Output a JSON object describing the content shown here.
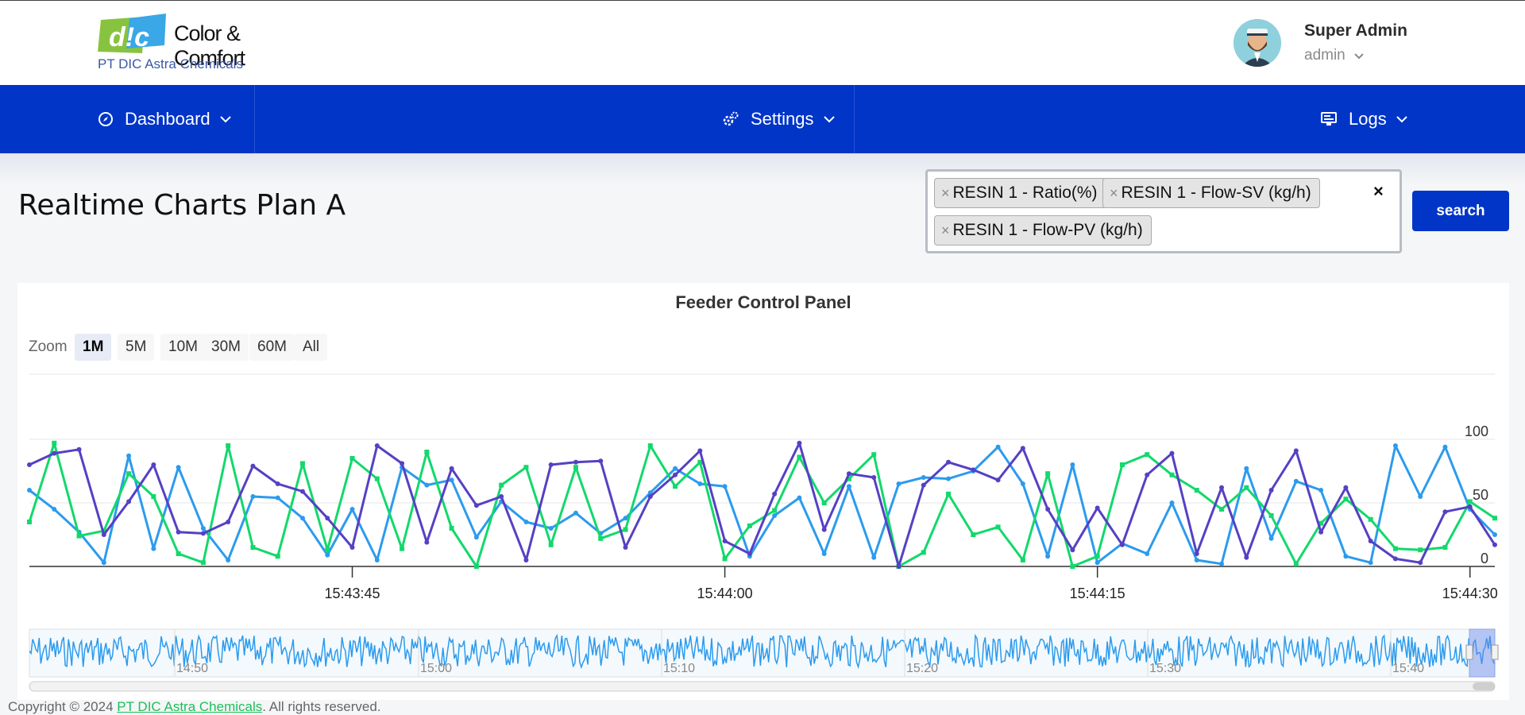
{
  "header": {
    "logo": {
      "mark": "DIC",
      "text": "Color & Comfort",
      "company": "PT DIC Astra Chemicals"
    },
    "user": {
      "name": "Super Admin",
      "role": "admin"
    }
  },
  "nav": {
    "items": [
      {
        "label": "Dashboard",
        "icon": "compass-icon"
      },
      {
        "label": "Settings",
        "icon": "gears-icon"
      },
      {
        "label": "Logs",
        "icon": "monitor-icon"
      }
    ]
  },
  "page": {
    "title": "Realtime Charts Plan A"
  },
  "filter": {
    "tags": [
      "RESIN 1 - Ratio(%)",
      "RESIN 1 - Flow-SV (kg/h)",
      "RESIN 1 - Flow-PV (kg/h)"
    ],
    "remove_symbol": "×",
    "clear_symbol": "×",
    "search_label": "search"
  },
  "colors": {
    "brand_blue": "#0035c8",
    "series_ratio": "#2b9bee",
    "series_flow_sv": "#12d96b",
    "series_flow_pv": "#5640c4",
    "footer_link": "#1cbf58"
  },
  "zoom": {
    "label": "Zoom",
    "options": [
      "1M",
      "5M",
      "10M",
      "30M",
      "60M",
      "All"
    ],
    "selected": "1M"
  },
  "chart_data": {
    "type": "line",
    "title": "Feeder Control Panel",
    "xlabel": "",
    "ylabel": "",
    "x_range": [
      "15:43:32",
      "15:44:31"
    ],
    "x_ticks": [
      "15:43:45",
      "15:44:00",
      "15:44:15",
      "15:44:30"
    ],
    "y_ticks": [
      0,
      50,
      100
    ],
    "ylim": [
      0,
      100
    ],
    "grid": true,
    "legend": "none",
    "x": [
      "15:43:32",
      "15:43:33",
      "15:43:34",
      "15:43:35",
      "15:43:36",
      "15:43:37",
      "15:43:38",
      "15:43:39",
      "15:43:40",
      "15:43:41",
      "15:43:42",
      "15:43:43",
      "15:43:44",
      "15:43:45",
      "15:43:46",
      "15:43:47",
      "15:43:48",
      "15:43:49",
      "15:43:50",
      "15:43:51",
      "15:43:52",
      "15:43:53",
      "15:43:54",
      "15:43:55",
      "15:43:56",
      "15:43:57",
      "15:43:58",
      "15:43:59",
      "15:44:00",
      "15:44:01",
      "15:44:02",
      "15:44:03",
      "15:44:04",
      "15:44:05",
      "15:44:06",
      "15:44:07",
      "15:44:08",
      "15:44:09",
      "15:44:10",
      "15:44:11",
      "15:44:12",
      "15:44:13",
      "15:44:14",
      "15:44:15",
      "15:44:16",
      "15:44:17",
      "15:44:18",
      "15:44:19",
      "15:44:20",
      "15:44:21",
      "15:44:22",
      "15:44:23",
      "15:44:24",
      "15:44:25",
      "15:44:26",
      "15:44:27",
      "15:44:28",
      "15:44:29",
      "15:44:30",
      "15:44:31"
    ],
    "series": [
      {
        "values": [
          60,
          45,
          27,
          3,
          87,
          14,
          78,
          30,
          5,
          55,
          54,
          38,
          9,
          45,
          5,
          78,
          64,
          68,
          23,
          51,
          35,
          30,
          42,
          26,
          38,
          58,
          77,
          65,
          63,
          8,
          40,
          54,
          10,
          63,
          7,
          65,
          70,
          69,
          75,
          94,
          65,
          8,
          80,
          3,
          18,
          10,
          50,
          5,
          2,
          77,
          22,
          67,
          60,
          8,
          3,
          95,
          55,
          94,
          45,
          25
        ]
      },
      {
        "values": [
          35,
          97,
          24,
          28,
          73,
          55,
          10,
          3,
          95,
          15,
          8,
          81,
          13,
          85,
          69,
          14,
          90,
          30,
          0,
          64,
          78,
          17,
          78,
          22,
          29,
          95,
          63,
          82,
          6,
          32,
          44,
          86,
          50,
          69,
          88,
          0,
          11,
          57,
          25,
          31,
          5,
          73,
          0,
          8,
          80,
          88,
          72,
          60,
          45,
          62,
          40,
          2,
          34,
          53,
          37,
          14,
          13,
          15,
          51,
          38
        ]
      },
      {
        "values": [
          80,
          89,
          92,
          25,
          51,
          80,
          27,
          26,
          35,
          79,
          65,
          59,
          38,
          15,
          95,
          81,
          19,
          77,
          48,
          55,
          5,
          80,
          82,
          83,
          15,
          55,
          72,
          91,
          20,
          10,
          57,
          97,
          29,
          73,
          70,
          0,
          64,
          82,
          76,
          68,
          93,
          45,
          13,
          46,
          17,
          72,
          89,
          10,
          62,
          7,
          60,
          91,
          27,
          62,
          20,
          6,
          3,
          43,
          47,
          17
        ]
      }
    ]
  },
  "navigator": {
    "labels": [
      "14:50",
      "15:00",
      "15:10",
      "15:20",
      "15:30",
      "15:40"
    ]
  },
  "footer": {
    "prefix": "Copyright © 2024",
    "link": "PT DIC Astra Chemicals",
    "suffix": ". All rights reserved."
  }
}
